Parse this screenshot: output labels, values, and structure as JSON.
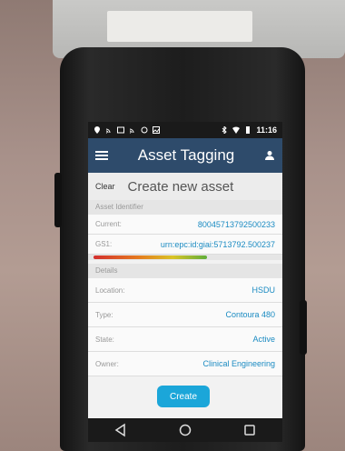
{
  "status_bar": {
    "time": "11:16",
    "icons": [
      "location-icon",
      "cast-icon",
      "gallery-icon",
      "cast-icon",
      "vpn-icon",
      "image-icon",
      "bluetooth-icon",
      "wifi-icon",
      "battery-icon"
    ]
  },
  "app_bar": {
    "title": "Asset Tagging",
    "menu_icon": "hamburger-menu-icon",
    "user_icon": "person-icon"
  },
  "header": {
    "clear_label": "Clear",
    "title": "Create new asset"
  },
  "asset_identifier": {
    "section_label": "Asset Identifier",
    "current_label": "Current:",
    "current_value": "800457137925002​33",
    "gs1_label": "GS1:",
    "gs1_value": "urn:epc:id:giai:5713792.500237",
    "signal_level": 0.62
  },
  "details": {
    "section_label": "Details",
    "fields": [
      {
        "label": "Location:",
        "value": "HSDU"
      },
      {
        "label": "Type:",
        "value": "Contoura 480"
      },
      {
        "label": "State:",
        "value": "Active"
      },
      {
        "label": "Owner:",
        "value": "Clinical Engineering"
      }
    ]
  },
  "actions": {
    "create_label": "Create"
  },
  "nav": {
    "back_icon": "back-triangle-icon",
    "home_icon": "home-circle-icon",
    "recents_icon": "recents-square-icon"
  },
  "colors": {
    "app_bar": "#2e4b6b",
    "accent": "#1ba6d9",
    "value_text": "#1b8bc2"
  }
}
